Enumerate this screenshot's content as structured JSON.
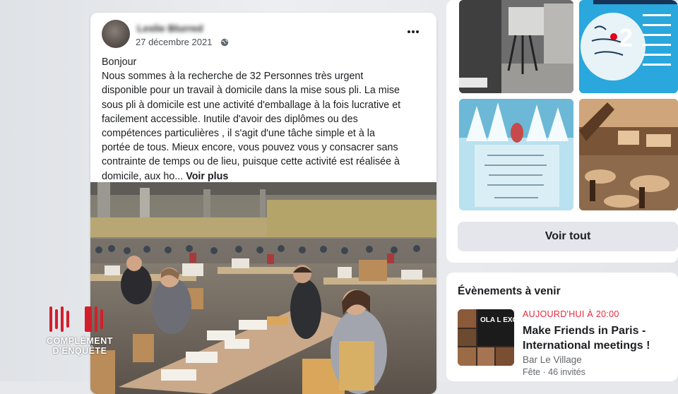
{
  "post": {
    "author_name": "Leslie Blurred",
    "date": "27 décembre 2021",
    "text_lines": [
      "Bonjour",
      "Nous sommes à la recherche de 32 Personnes très urgent",
      "disponible pour un travail à domicile dans la mise sous pli. La mise",
      "sous pli à domicile est une activité d'emballage à la fois lucrative et",
      "facilement accessible. Inutile d'avoir des diplômes ou des",
      "compétences particulières , il s'agit d'une tâche simple et à la",
      "portée de tous. Mieux encore, vous pouvez vous y consacrer sans",
      "contrainte de temps ou de lieu, puisque cette activité  est réalisée à"
    ],
    "last_line": "domicile, aux ho...",
    "see_more": "Voir plus"
  },
  "photos": {
    "see_all": "Voir tout"
  },
  "events": {
    "title": "Évènements à venir",
    "item": {
      "date": "AUJOURD'HUI À 20:00",
      "title": "Make Friends in Paris - International meetings !",
      "venue": "Bar Le Village",
      "meta": "Fête · 46 invités",
      "thumb_text": "OLA L EXCHAN"
    }
  },
  "overlay": {
    "channel": "2",
    "show_line1": "COMPLÉMENT",
    "show_line2": "D'ENQUÊTE"
  },
  "colors": {
    "event_date": "#e4283b",
    "channel_dot": "#e3001b",
    "show_red": "#d21f2b"
  }
}
